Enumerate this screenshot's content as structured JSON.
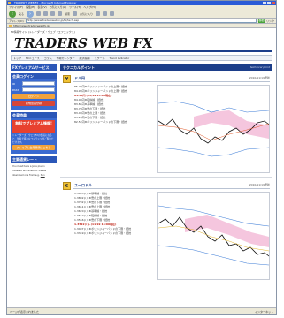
{
  "window": {
    "title": "TRADER'S WEB FX - Microsoft Internet Explorer"
  },
  "menu": [
    "ファイル(F)",
    "編集(E)",
    "表示(V)",
    "お気に入り(A)",
    "ツール(T)",
    "ヘルプ(H)"
  ],
  "toolbar": {
    "back": "戻る",
    "forward": "",
    "search": "検索",
    "favorites": "お気に入り"
  },
  "address": {
    "label": "アドレス(D)",
    "value": "http://www.traderswebfx.jp/fx/tech.asp",
    "go": "移動",
    "links": "リンク"
  },
  "favbar": {
    "text": "http://www.traderswebfx.jp"
  },
  "site": {
    "tagline": "FX情報サイト (トレーダーズ・ウェブ・エフエックス)",
    "logo": "TRADERS WEB FX"
  },
  "nav": [
    "トップ",
    "FXニュース",
    "コラム",
    "市場カレンダー",
    "経済指標",
    "スクール",
    "Trend Indicator"
  ],
  "left": {
    "premium_title": "FXプレミアムサービス",
    "login_head": "会員ログイン",
    "id_label": "ID",
    "pass_label": "PASS",
    "login_btn": "ログイン",
    "register_btn": "新規会員登録",
    "member_head": "会員特典",
    "promo_text": "無料でプレミアム情報!",
    "member_text": "トレーダーズ・ウェブFXの会員になると、無料で様々なコンテンツがご覧いただけます。",
    "member_btn": "プレミアム会員登録はこちら",
    "flash_head": "主要通貨レート",
    "flash_text": "You must have a Java plugin installed and enabled. Please download one from e.g.",
    "flash_link": "Sun"
  },
  "main": {
    "section_title": "テクニカルポイント",
    "section_sub": "technical point",
    "jpy": {
      "icon": "¥",
      "title": "ドル円",
      "date": "2010/11/19更新",
      "levels": [
        "85.20円★ボリンジャーバンドの上限・抵抗",
        "84.99円★ボリンジャーバンドの上限・抵抗",
        "84.65円   (11/19 15:00現在)",
        "84.00円★転換線・抵抗",
        "83.84円★基準線・抵抗",
        "83.70円★雲の下限・抵抗",
        "83.49円★雲の上限・抵抗",
        "83.20円★雲の下限・抵抗",
        "82.52円★ボリンジャーバンドの下限・抵抗"
      ]
    },
    "eur": {
      "icon": "€",
      "title": "ユーロドル",
      "date": "2010/11/19更新",
      "levels": [
        "1.3853ドル★基準線・抵抗",
        "1.3802ドル★雲の上限・抵抗",
        "1.3702ドル★雲の下限・抵抗",
        "1.3651ドル★雲の上限・抵抗",
        "1.3620ドル★基準線・抵抗",
        "1.3610ドル★転換線・抵抗",
        "1.3556ドル★雲の下限・抵抗",
        "1.3522ドル   (11/19 15:00現在)",
        "1.3407ドル★ボリンジャーバンドの下限・抵抗",
        "1.3349ドル★ボリンジャーバンドの下限・抵抗"
      ]
    }
  },
  "status": {
    "left": "ページが表示されました",
    "right": "インターネット"
  },
  "colors": {
    "brand": "#1c3e8a",
    "left_panel": "#2b57b8",
    "accent": "#c0271a"
  }
}
